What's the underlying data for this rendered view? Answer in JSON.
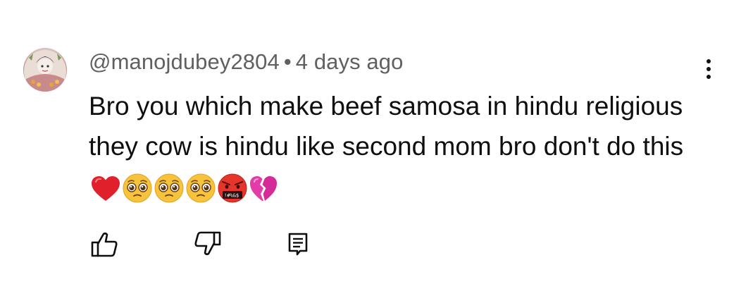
{
  "comment": {
    "author": "@manojdubey2804",
    "separator": "•",
    "timestamp": "4 days ago",
    "text": "Bro you which make beef samosa in hindu religious they cow is hindu like second mom bro don't do this",
    "emojis": [
      "red-heart",
      "pleading-face",
      "pleading-face",
      "pleading-face",
      "face-with-symbols-on-mouth",
      "broken-heart"
    ]
  },
  "icons": {
    "like": "thumbs-up-icon",
    "dislike": "thumbs-down-icon",
    "reply": "reply-icon",
    "menu": "more-vert-icon"
  }
}
